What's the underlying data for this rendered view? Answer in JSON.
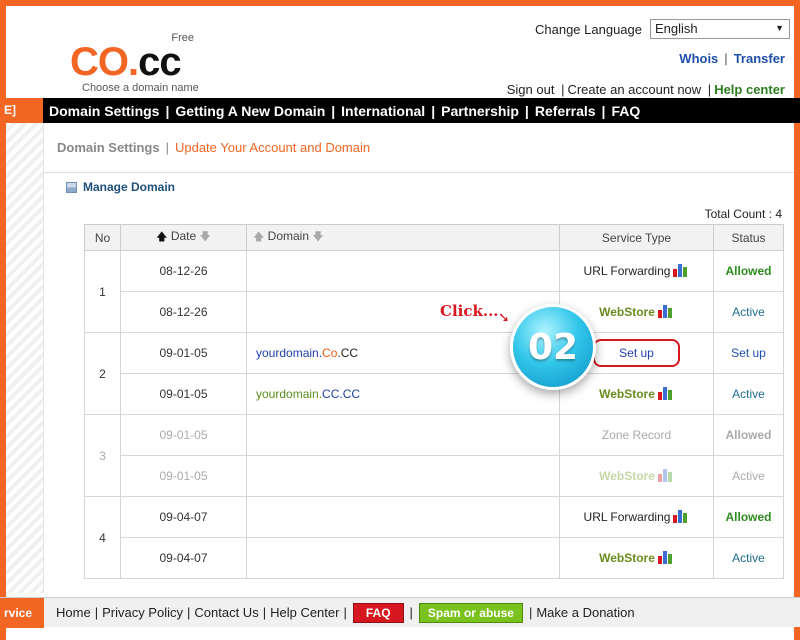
{
  "logo": {
    "free": "Free",
    "co": "CO",
    "dot": ".",
    "cc": "cc",
    "tagline": "Choose a domain name"
  },
  "language": {
    "label": "Change Language",
    "selected": "English"
  },
  "toplinks": {
    "whois": "Whois",
    "sep": "|",
    "transfer": "Transfer"
  },
  "account": {
    "signout": "Sign out",
    "sep": "|",
    "create": "Create an account now",
    "help": "Help center"
  },
  "nav": {
    "tab": "E]",
    "items": [
      "Domain Settings",
      "Getting A New Domain",
      "International",
      "Partnership",
      "Referrals",
      "FAQ"
    ],
    "sep": "|"
  },
  "breadcrumb": {
    "main": "Domain Settings",
    "sep": "|",
    "sub": "Update Your Account and Domain"
  },
  "manage": {
    "title": "Manage Domain"
  },
  "total": "Total Count : 4",
  "table": {
    "headers": {
      "no": "No",
      "date": "Date",
      "domain": "Domain",
      "service": "Service Type",
      "status": "Status"
    },
    "groups": [
      {
        "no": "1",
        "rows": [
          {
            "date": "08-12-26",
            "domain": "",
            "service": "URL Forwarding",
            "service_kind": "url",
            "status": "Allowed"
          },
          {
            "date": "08-12-26",
            "domain": "",
            "service": "WebStore",
            "service_kind": "webstore",
            "status": "Active"
          }
        ]
      },
      {
        "no": "2",
        "rows": [
          {
            "date": "09-01-05",
            "domain_parts": [
              "yourdomain.",
              "Co",
              ".CC"
            ],
            "service": "Set up",
            "status": "Set up"
          },
          {
            "date": "09-01-05",
            "domain_parts": [
              "yourdomain.",
              "CC.CC"
            ],
            "service": "WebStore",
            "status": "Active"
          }
        ]
      },
      {
        "no": "3",
        "rows": [
          {
            "date": "09-01-05",
            "domain": "",
            "service": "Zone Record",
            "status": "Allowed"
          },
          {
            "date": "09-01-05",
            "domain": "",
            "service": "WebStore",
            "status": "Active"
          }
        ]
      },
      {
        "no": "4",
        "rows": [
          {
            "date": "09-04-07",
            "domain": "",
            "service": "URL Forwarding",
            "status": "Allowed"
          },
          {
            "date": "09-04-07",
            "domain": "",
            "service": "WebStore",
            "status": "Active"
          }
        ]
      }
    ]
  },
  "annotation": {
    "click": "Click...",
    "step": "02"
  },
  "footer": {
    "tab": "rvice",
    "home": "Home",
    "privacy": "Privacy Policy",
    "contact": "Contact Us",
    "help": "Help Center",
    "faq": "FAQ",
    "spam": "Spam or abuse",
    "donate": "Make a Donation",
    "sep": "|"
  },
  "colors": {
    "brand_orange": "#f26522",
    "nav_black": "#000000",
    "link_blue": "#1f4fa8",
    "allowed_green": "#2e8b1f",
    "highlight_red": "#d6171f",
    "badge_cyan": "#31c6ea"
  }
}
